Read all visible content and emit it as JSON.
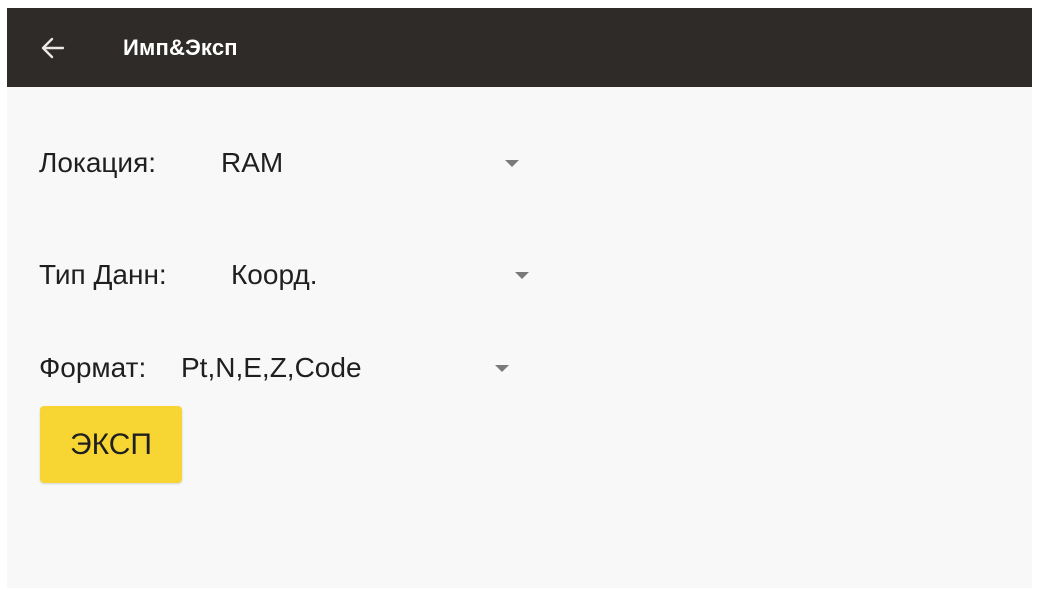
{
  "appbar": {
    "back_icon": "arrow-left-icon",
    "title": "Имп&Эксп"
  },
  "location": {
    "label": "Локация:",
    "value": "RAM",
    "icon": "dropdown-caret-icon"
  },
  "data_type": {
    "label": "Тип Данн:",
    "value": "Коорд.",
    "icon": "dropdown-caret-icon"
  },
  "format": {
    "label": "Формат:",
    "value": "Pt,N,E,Z,Code",
    "icon": "dropdown-caret-icon"
  },
  "export_button": {
    "label": "ЭКСП"
  },
  "colors": {
    "appbar_bg": "#2f2b28",
    "screen_bg": "#f8f8f8",
    "button_bg": "#f7d633",
    "text": "#1f1f1f",
    "caret": "#7a7a7a"
  }
}
